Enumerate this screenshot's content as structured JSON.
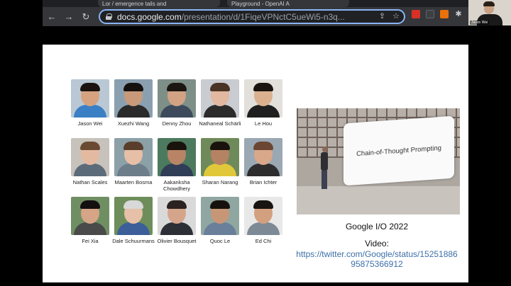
{
  "browser": {
    "tabs": [
      {
        "label": "Lor / emergence tails and"
      },
      {
        "label": "Playground - OpenAI A"
      }
    ],
    "url_host": "docs.google.com",
    "url_path": "/presentation/d/1FiqeVPNctC5ueWi5-n3q...",
    "icons": [
      "back-arrow-icon",
      "forward-arrow-icon",
      "reload-icon",
      "lock-icon",
      "share-icon",
      "star-icon",
      "puzzle-icon",
      "side-panel-icon"
    ]
  },
  "presenter": {
    "name": "Jason Wei"
  },
  "slide": {
    "people": [
      {
        "name": "Jason Wei",
        "face": "#d7a27f",
        "hair": "#1b1410",
        "shirt": "#3b7fc4",
        "bg": "#b9c8d4"
      },
      {
        "name": "Xuezhi Wang",
        "face": "#c99a7a",
        "hair": "#15110f",
        "shirt": "#2a2a2a",
        "bg": "#8aa0b0"
      },
      {
        "name": "Denny Zhou",
        "face": "#d1a283",
        "hair": "#1c1612",
        "shirt": "#3c4a5c",
        "bg": "#7e8f88"
      },
      {
        "name": "Nathaneal Schärli",
        "face": "#e2b8a0",
        "hair": "#4a3426",
        "shirt": "#2b2b2b",
        "bg": "#c9ccd0"
      },
      {
        "name": "Le Hou",
        "face": "#dbb08f",
        "hair": "#1a1410",
        "shirt": "#1f1f1f",
        "bg": "#e3e0dc"
      },
      {
        "name": "Nathan Scales",
        "face": "#e3b9a0",
        "hair": "#6b4a33",
        "shirt": "#5b6b7a",
        "bg": "#c7c2bb"
      },
      {
        "name": "Maarten Bosma",
        "face": "#e7bfa6",
        "hair": "#5a3e2c",
        "shirt": "#6d7d8a",
        "bg": "#8ca0a8"
      },
      {
        "name": "Aakanksha Chowdhery",
        "face": "#b98466",
        "hair": "#1a120d",
        "shirt": "#2f3d57",
        "bg": "#4c7a5e"
      },
      {
        "name": "Sharan Narang",
        "face": "#b58264",
        "hair": "#1a120d",
        "shirt": "#e1c83a",
        "bg": "#6f8a5a"
      },
      {
        "name": "Brian Ichter",
        "face": "#d9a88a",
        "hair": "#6b4632",
        "shirt": "#2d2d2d",
        "bg": "#9aa8b3"
      },
      {
        "name": "Fei Xia",
        "face": "#d6a486",
        "hair": "#141010",
        "shirt": "#4a4a4a",
        "bg": "#6f8f63"
      },
      {
        "name": "Dale Schuurmans",
        "face": "#e6c0a8",
        "hair": "#d8d8d8",
        "shirt": "#3c5f9a",
        "bg": "#6d8e5a"
      },
      {
        "name": "Olivier Bousquet",
        "face": "#d5a58b",
        "hair": "#2a2220",
        "shirt": "#2c2f36",
        "bg": "#d9d9d9"
      },
      {
        "name": "Quoc Le",
        "face": "#c79676",
        "hair": "#15110e",
        "shirt": "#6a7f9a",
        "bg": "#8fa7a0"
      },
      {
        "name": "Ed Chi",
        "face": "#d3a07f",
        "hair": "#1a1410",
        "shirt": "#7d8a96",
        "bg": "#e8e8e8"
      }
    ],
    "video_screen_text": "Chain-of-Thought Prompting",
    "caption": "Google I/O 2022",
    "video_label": "Video:",
    "video_link": "https://twitter.com/Google/status/1525188695875366912"
  },
  "colors": {
    "omnibox_border": "#8ab4f8",
    "link": "#3c6fa8"
  }
}
